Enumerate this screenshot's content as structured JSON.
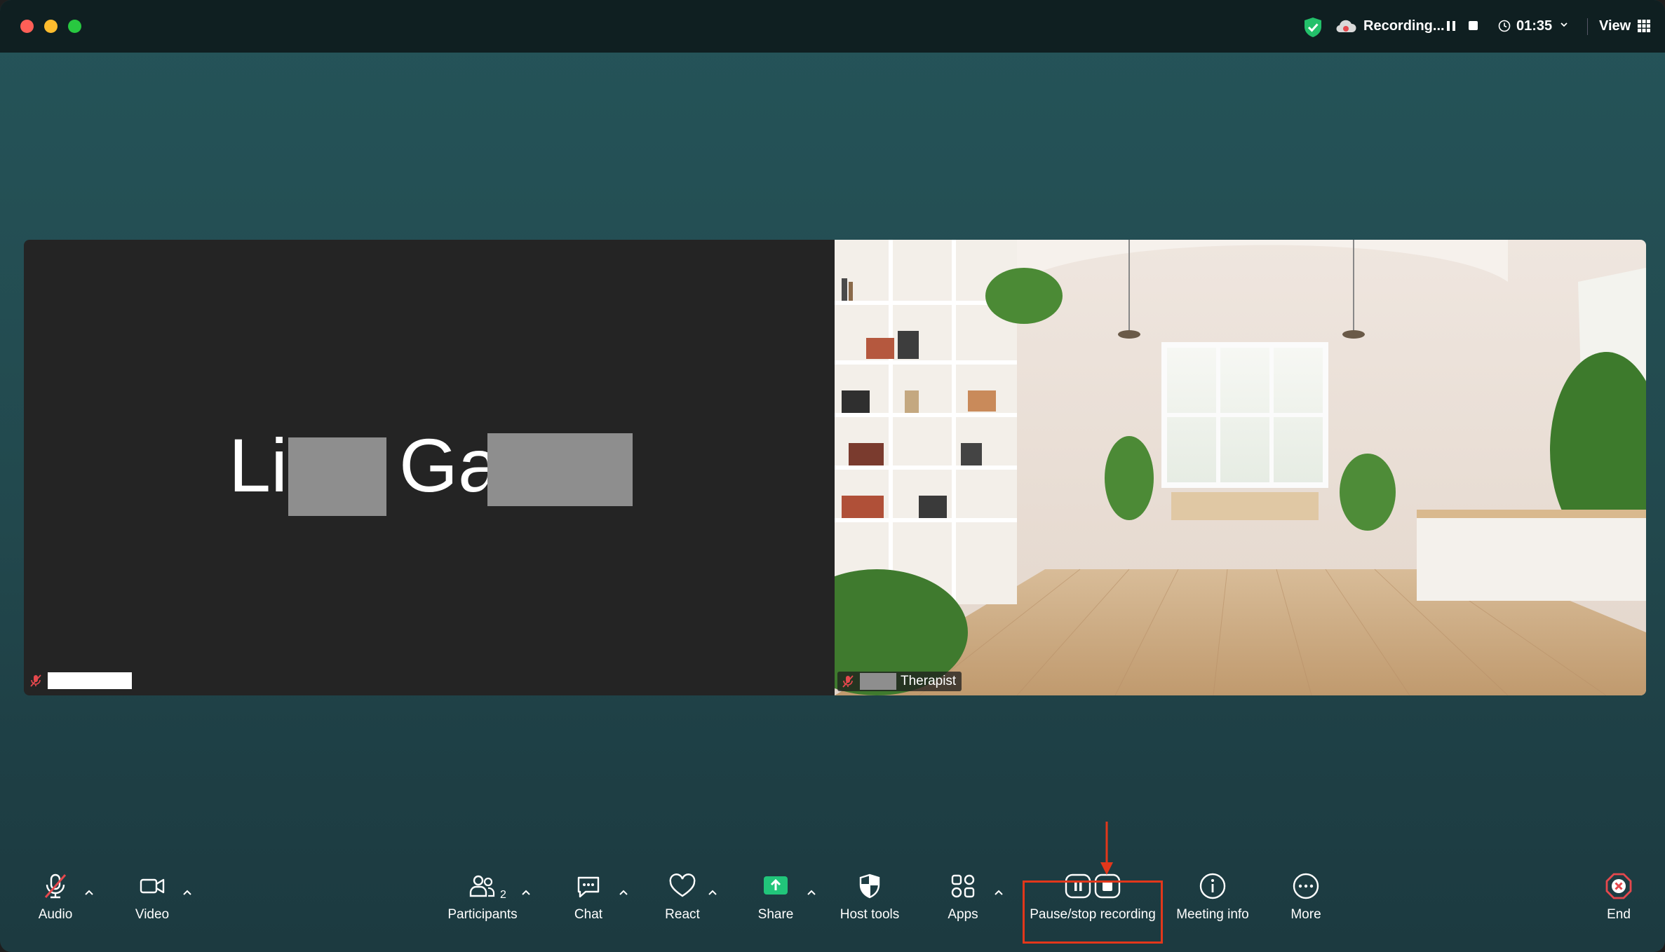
{
  "titlebar": {
    "recording_label": "Recording...",
    "timer": "01:35",
    "view_label": "View",
    "icons": [
      "shield-check-icon",
      "cloud-record-icon",
      "pause-icon",
      "stop-icon",
      "clock-icon",
      "chevron-down-icon",
      "grid-icon"
    ]
  },
  "participants": {
    "left": {
      "name_part1": "Li",
      "name_part2": "Ga"
    },
    "right": {
      "name_label": "Therapist"
    }
  },
  "toolbar": {
    "audio": "Audio",
    "video": "Video",
    "participants": "Participants",
    "participants_count": "2",
    "chat": "Chat",
    "react": "React",
    "share": "Share",
    "host_tools": "Host tools",
    "apps": "Apps",
    "pause_stop": "Pause/stop recording",
    "meeting_info": "Meeting info",
    "more": "More",
    "end": "End"
  },
  "colors": {
    "accent_green": "#21c57a",
    "annotation_red": "#e2371b",
    "end_red": "#e5484d"
  }
}
